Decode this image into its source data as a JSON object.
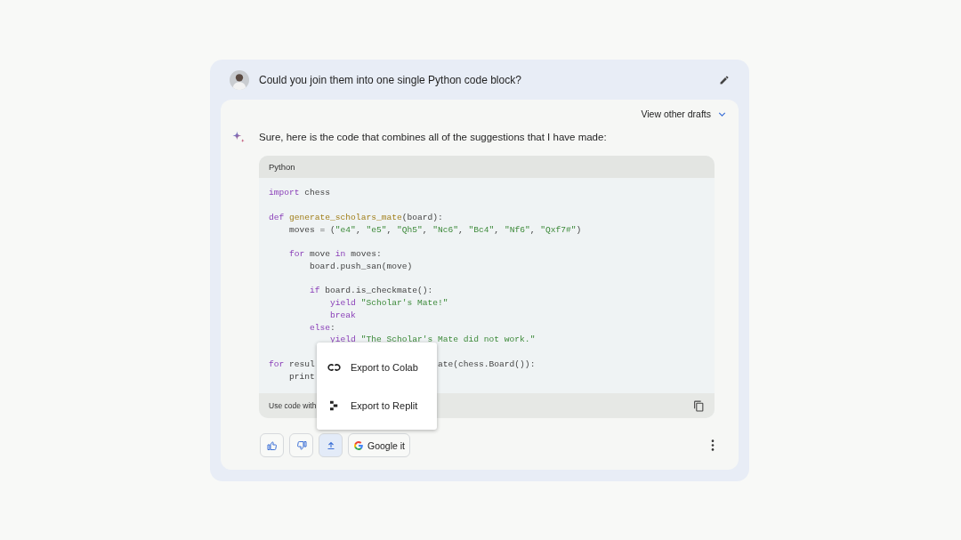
{
  "prompt": {
    "text": "Could you join them into one single Python code block?"
  },
  "response": {
    "drafts_label": "View other drafts",
    "drafts_expanded": false,
    "intro": "Sure, here is the code that combines all of the suggestions that I have made:",
    "code_block": {
      "language": "Python",
      "footer": "Use code with",
      "lines": [
        [
          [
            {
              "kind": "keyword",
              "text": "import"
            },
            {
              "kind": "plain",
              "text": " chess"
            }
          ]
        ],
        [
          [
            {
              "kind": "keyword",
              "text": "def "
            },
            {
              "kind": "function",
              "text": "generate_scholars_mate"
            },
            {
              "kind": "plain",
              "text": "(board):"
            }
          ],
          [
            {
              "kind": "plain",
              "text": "    moves = ("
            },
            {
              "kind": "string",
              "text": "\"e4\""
            },
            {
              "kind": "plain",
              "text": ", "
            },
            {
              "kind": "string",
              "text": "\"e5\""
            },
            {
              "kind": "plain",
              "text": ", "
            },
            {
              "kind": "string",
              "text": "\"Qh5\""
            },
            {
              "kind": "plain",
              "text": ", "
            },
            {
              "kind": "string",
              "text": "\"Nc6\""
            },
            {
              "kind": "plain",
              "text": ", "
            },
            {
              "kind": "string",
              "text": "\"Bc4\""
            },
            {
              "kind": "plain",
              "text": ", "
            },
            {
              "kind": "string",
              "text": "\"Nf6\""
            },
            {
              "kind": "plain",
              "text": ", "
            },
            {
              "kind": "string",
              "text": "\"Qxf7#\""
            },
            {
              "kind": "plain",
              "text": ")"
            }
          ]
        ],
        [
          [
            {
              "kind": "keyword",
              "text": "    for"
            },
            {
              "kind": "plain",
              "text": " move "
            },
            {
              "kind": "keyword",
              "text": "in"
            },
            {
              "kind": "plain",
              "text": " moves:"
            }
          ],
          [
            {
              "kind": "plain",
              "text": "        board.push_san(move)"
            }
          ]
        ],
        [
          [
            {
              "kind": "keyword",
              "text": "        if"
            },
            {
              "kind": "plain",
              "text": " board.is_checkmate():"
            }
          ],
          [
            {
              "kind": "keyword",
              "text": "            yield "
            },
            {
              "kind": "string",
              "text": "\"Scholar's Mate!\""
            }
          ],
          [
            {
              "kind": "keyword",
              "text": "            break"
            }
          ],
          [
            {
              "kind": "keyword",
              "text": "        else"
            },
            {
              "kind": "plain",
              "text": ":"
            }
          ],
          [
            {
              "kind": "keyword",
              "text": "            yield "
            },
            {
              "kind": "string",
              "text": "\"The Scholar's Mate did not work.\""
            }
          ]
        ],
        [
          [
            {
              "kind": "keyword",
              "text": "for"
            },
            {
              "kind": "plain",
              "text": " resul"
            },
            {
              "kind": "covered"
            },
            {
              "kind": "plain",
              "text": "ate(chess.Board()):"
            }
          ],
          [
            {
              "kind": "plain",
              "text": "    print"
            }
          ]
        ]
      ]
    },
    "export_menu": [
      {
        "kind": "colab",
        "label": "Export to Colab"
      },
      {
        "kind": "replit",
        "label": "Export to Replit"
      }
    ],
    "actions": [
      {
        "kind": "thumbs-up",
        "selected": false
      },
      {
        "kind": "thumbs-down",
        "selected": false
      },
      {
        "kind": "share",
        "selected": true
      },
      {
        "kind": "google",
        "label": "Google it",
        "selected": false
      }
    ]
  }
}
